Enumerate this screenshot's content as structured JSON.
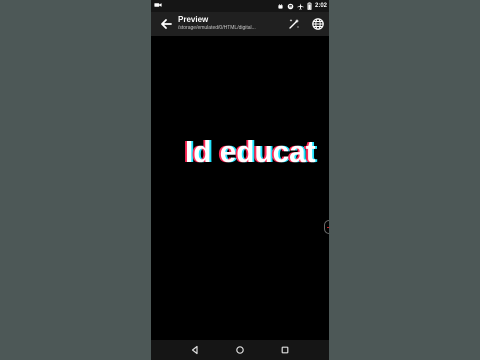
{
  "status_bar": {
    "time": "2:02",
    "icons": [
      "video-camera-icon",
      "android-icon",
      "message-icon",
      "airplane-icon",
      "battery-icon"
    ]
  },
  "app_bar": {
    "title": "Preview",
    "path": "/storage/emulated/0/HTML/digital..."
  },
  "content": {
    "preview_text": "Id educat"
  },
  "icons": {
    "back": "back-arrow-icon",
    "action_1": "wand-sparkle-icon",
    "action_2": "globe-icon",
    "edge": "edge-handle-icon",
    "nav_back": "triangle-back-icon",
    "nav_home": "circle-home-icon",
    "nav_recent": "square-recent-icon"
  },
  "colors": {
    "page_bg": "#4d5857",
    "phone_bg": "#000000",
    "app_bar_bg": "#202020",
    "status_bg": "#151515",
    "text_primary": "#ffffff",
    "text_secondary": "#c7c7c7",
    "glitch_red": "#ff2b59",
    "glitch_cyan": "#22e5ff"
  }
}
